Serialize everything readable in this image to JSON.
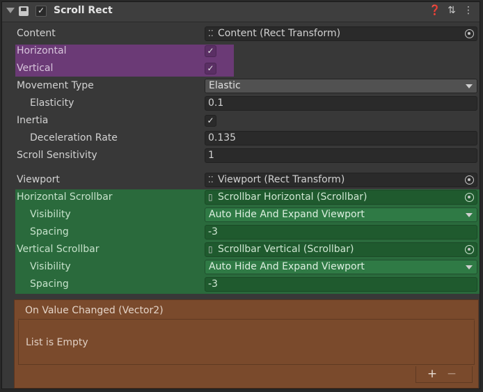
{
  "component": {
    "title": "Scroll Rect"
  },
  "header_icons": [
    "help-icon",
    "preset-icon",
    "more-icon"
  ],
  "properties": {
    "content": {
      "label": "Content",
      "value": "Content (Rect Transform)",
      "icon": "rect-transform-icon"
    },
    "horizontal": {
      "label": "Horizontal",
      "checked": true
    },
    "vertical": {
      "label": "Vertical",
      "checked": true
    },
    "movement_type": {
      "label": "Movement Type",
      "value": "Elastic"
    },
    "elasticity": {
      "label": "Elasticity",
      "value": "0.1"
    },
    "inertia": {
      "label": "Inertia",
      "checked": true
    },
    "deceleration_rate": {
      "label": "Deceleration Rate",
      "value": "0.135"
    },
    "scroll_sensitivity": {
      "label": "Scroll Sensitivity",
      "value": "1"
    },
    "viewport": {
      "label": "Viewport",
      "value": "Viewport (Rect Transform)",
      "icon": "rect-transform-icon"
    },
    "horizontal_scrollbar": {
      "label": "Horizontal Scrollbar",
      "value": "Scrollbar Horizontal (Scrollbar)",
      "icon": "scrollbar-icon"
    },
    "h_visibility": {
      "label": "Visibility",
      "value": "Auto Hide And Expand Viewport"
    },
    "h_spacing": {
      "label": "Spacing",
      "value": "-3"
    },
    "vertical_scrollbar": {
      "label": "Vertical Scrollbar",
      "value": "Scrollbar Vertical (Scrollbar)",
      "icon": "scrollbar-icon"
    },
    "v_visibility": {
      "label": "Visibility",
      "value": "Auto Hide And Expand Viewport"
    },
    "v_spacing": {
      "label": "Spacing",
      "value": "-3"
    }
  },
  "event": {
    "title": "On Value Changed (Vector2)",
    "empty_text": "List is Empty",
    "add_label": "+",
    "remove_label": "−"
  },
  "colors": {
    "highlight_purple": "#6b3a76",
    "highlight_green": "#2a6a3c",
    "highlight_orange": "#7a4a2c"
  }
}
